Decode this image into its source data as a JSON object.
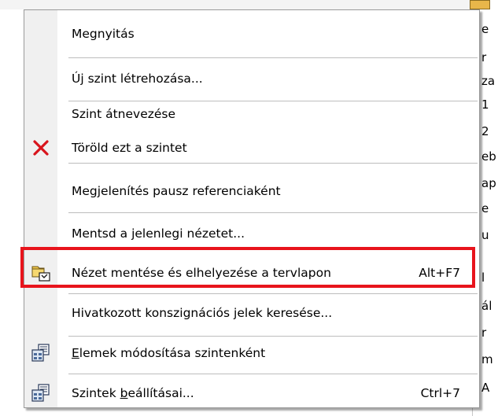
{
  "background": {
    "fragments": [
      "e",
      "r",
      "za",
      "1",
      "2",
      "eb",
      "ap",
      "e",
      "u",
      "l",
      "ál",
      "r",
      "m",
      "A"
    ]
  },
  "menu": {
    "items": [
      {
        "label": "Megnyitás",
        "shortcut": "",
        "icon": ""
      },
      {
        "label": "Új szint létrehozása...",
        "shortcut": "",
        "icon": ""
      },
      {
        "label": "Szint átnevezése",
        "shortcut": "",
        "icon": ""
      },
      {
        "label": "Töröld ezt a szintet",
        "shortcut": "",
        "icon": "delete-x-icon"
      },
      {
        "label": "Megjelenítés pausz referenciaként",
        "shortcut": "",
        "icon": ""
      },
      {
        "label": "Mentsd a jelenlegi nézetet...",
        "shortcut": "",
        "icon": ""
      },
      {
        "label": "Nézet mentése és elhelyezése a tervlapon",
        "shortcut": "Alt+F7",
        "icon": "save-view-layout-icon"
      },
      {
        "label": "Hivatkozott konszignációs jelek keresése...",
        "shortcut": "",
        "icon": ""
      },
      {
        "label_pre": "",
        "label_ul": "E",
        "label_post": "lemek módosítása szintenként",
        "shortcut": "",
        "icon": "story-settings-icon"
      },
      {
        "label_pre": "Szintek ",
        "label_ul": "b",
        "label_post": "eállításai...",
        "shortcut": "Ctrl+7",
        "icon": "story-settings-icon"
      }
    ],
    "highlight_color": "#e8141c",
    "delete_icon_color": "#d8141c"
  }
}
